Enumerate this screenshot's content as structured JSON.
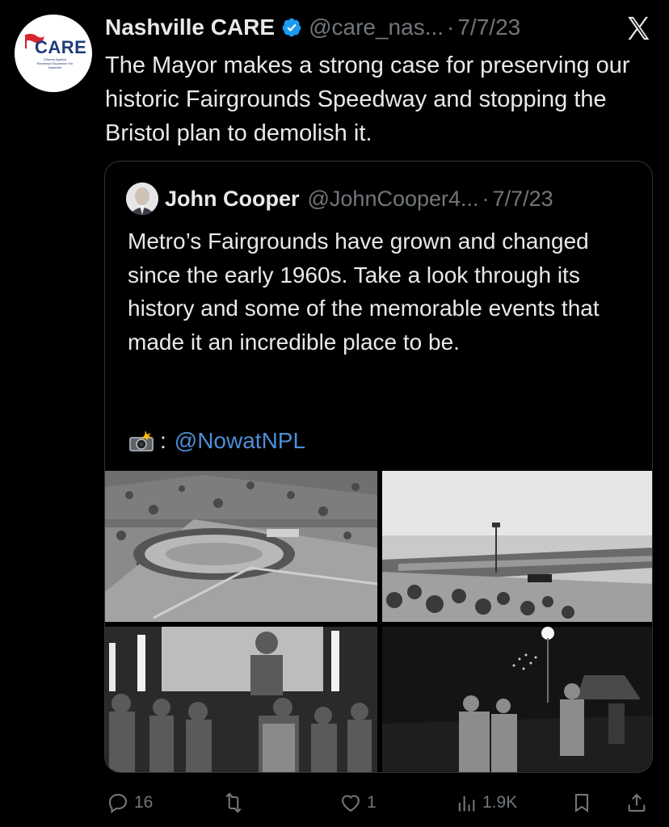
{
  "tweet": {
    "author_name": "Nashville CARE",
    "handle": "@care_nas...",
    "separator": "·",
    "date": "7/7/23",
    "text": "The Mayor makes a strong case for preserving our historic Fairgrounds Speedway and stopping the Bristol plan to demolish it.",
    "avatar_text": "CARE",
    "avatar_subtext": "Citizens Against Racetrack Expansion For Nashville"
  },
  "quoted_tweet": {
    "author_name": "John Cooper",
    "handle": "@JohnCooper4...",
    "separator": "·",
    "date": "7/7/23",
    "text": "Metro’s Fairgrounds have grown and changed since the early 1960s. Take a look through its history and some of the memorable events that made it an incredible place to be.",
    "credit_separator": ":",
    "credit_mention": "@NowatNPL",
    "photos": [
      {
        "name": "aerial-speedway-photo"
      },
      {
        "name": "race-crowd-photo"
      },
      {
        "name": "fair-crowd-photo"
      },
      {
        "name": "fireworks-night-photo"
      }
    ]
  },
  "actions": {
    "replies": "16",
    "reposts": "",
    "likes": "1",
    "views": "1.9K"
  },
  "colors": {
    "background": "#000000",
    "text": "#e7e9ea",
    "secondary": "#71767b",
    "link": "#4c8fd6",
    "verified": "#1d9bf0",
    "border": "#2f3336"
  }
}
